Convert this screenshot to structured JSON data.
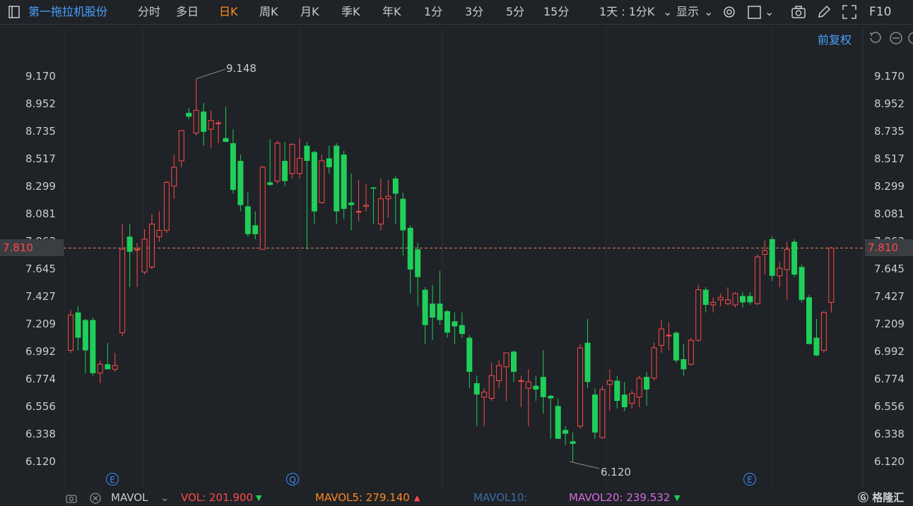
{
  "toolbar": {
    "stock_name": "第一拖拉机股份",
    "periods": [
      "分时",
      "多日",
      "日K",
      "周K",
      "月K",
      "季K",
      "年K",
      "1分",
      "3分",
      "5分",
      "15分"
    ],
    "active_period": "日K",
    "range_select": "1天 : 1分K",
    "display_label": "显示",
    "f10_label": "F10"
  },
  "chart": {
    "adjust_label": "前复权",
    "y_ticks": [
      "9.170",
      "8.952",
      "8.735",
      "8.517",
      "8.299",
      "8.081",
      "7.863",
      "7.645",
      "7.427",
      "7.209",
      "6.992",
      "6.774",
      "6.556",
      "6.338",
      "6.120"
    ],
    "current_price": "7.810",
    "high_label": "9.148",
    "low_label": "6.120",
    "event_markers": [
      "E",
      "Q",
      "E"
    ]
  },
  "bottom": {
    "indicator": "MAVOL",
    "vol": "VOL: 201.900",
    "mavol5": "MAVOL5: 279.140",
    "mavol10": "MAVOL10:",
    "mavol20": "MAVOL20: 239.532",
    "watermark": "格隆汇"
  },
  "colors": {
    "up": "#ff4a4a",
    "down": "#1fcf5a",
    "accent_blue": "#4aa0ff",
    "active_orange": "#ff8a1f",
    "mavol5": "#ff8a1f",
    "mavol10": "#3a6fa8",
    "mavol20": "#d86be0"
  },
  "chart_data": {
    "type": "candlestick",
    "ylim": [
      6.12,
      9.17
    ],
    "candles": [
      {
        "o": 7.0,
        "h": 7.32,
        "l": 6.98,
        "c": 7.28
      },
      {
        "o": 7.3,
        "h": 7.35,
        "l": 7.0,
        "c": 7.1
      },
      {
        "o": 7.24,
        "h": 7.25,
        "l": 6.82,
        "c": 7.0
      },
      {
        "o": 7.24,
        "h": 7.26,
        "l": 6.8,
        "c": 6.82
      },
      {
        "o": 6.82,
        "h": 6.92,
        "l": 6.74,
        "c": 6.89
      },
      {
        "o": 6.89,
        "h": 7.06,
        "l": 6.85,
        "c": 6.85
      },
      {
        "o": 6.85,
        "h": 6.98,
        "l": 6.83,
        "c": 6.88
      },
      {
        "o": 7.14,
        "h": 8.0,
        "l": 7.11,
        "c": 7.8
      },
      {
        "o": 7.9,
        "h": 8.0,
        "l": 7.5,
        "c": 7.78
      },
      {
        "o": 7.8,
        "h": 7.85,
        "l": 7.5,
        "c": 7.8
      },
      {
        "o": 7.62,
        "h": 7.96,
        "l": 7.6,
        "c": 7.88
      },
      {
        "o": 7.66,
        "h": 8.08,
        "l": 7.64,
        "c": 8.0
      },
      {
        "o": 7.9,
        "h": 8.1,
        "l": 7.86,
        "c": 7.95
      },
      {
        "o": 7.95,
        "h": 8.34,
        "l": 7.93,
        "c": 8.33
      },
      {
        "o": 8.3,
        "h": 8.55,
        "l": 8.2,
        "c": 8.45
      },
      {
        "o": 8.5,
        "h": 8.7,
        "l": 8.45,
        "c": 8.74
      },
      {
        "o": 8.88,
        "h": 8.92,
        "l": 8.83,
        "c": 8.85
      },
      {
        "o": 8.72,
        "h": 9.15,
        "l": 8.7,
        "c": 8.9
      },
      {
        "o": 8.89,
        "h": 8.96,
        "l": 8.62,
        "c": 8.73
      },
      {
        "o": 8.75,
        "h": 8.9,
        "l": 8.6,
        "c": 8.82
      },
      {
        "o": 8.8,
        "h": 8.82,
        "l": 8.64,
        "c": 8.8
      },
      {
        "o": 8.68,
        "h": 8.93,
        "l": 8.66,
        "c": 8.65
      },
      {
        "o": 8.64,
        "h": 8.75,
        "l": 8.24,
        "c": 8.27
      },
      {
        "o": 8.5,
        "h": 8.55,
        "l": 8.1,
        "c": 8.15
      },
      {
        "o": 8.14,
        "h": 8.25,
        "l": 7.9,
        "c": 7.92
      },
      {
        "o": 7.99,
        "h": 8.1,
        "l": 7.88,
        "c": 7.92
      },
      {
        "o": 7.8,
        "h": 8.46,
        "l": 7.8,
        "c": 8.45
      },
      {
        "o": 8.33,
        "h": 8.67,
        "l": 8.3,
        "c": 8.31
      },
      {
        "o": 8.34,
        "h": 8.66,
        "l": 8.32,
        "c": 8.64
      },
      {
        "o": 8.5,
        "h": 8.65,
        "l": 8.3,
        "c": 8.34
      },
      {
        "o": 8.4,
        "h": 8.64,
        "l": 8.36,
        "c": 8.63
      },
      {
        "o": 8.4,
        "h": 8.68,
        "l": 8.36,
        "c": 8.52
      },
      {
        "o": 8.62,
        "h": 8.65,
        "l": 7.8,
        "c": 8.5
      },
      {
        "o": 8.57,
        "h": 8.58,
        "l": 8.0,
        "c": 8.1
      },
      {
        "o": 8.17,
        "h": 8.55,
        "l": 8.16,
        "c": 8.5
      },
      {
        "o": 8.52,
        "h": 8.62,
        "l": 8.4,
        "c": 8.45
      },
      {
        "o": 8.62,
        "h": 8.64,
        "l": 8.0,
        "c": 8.1
      },
      {
        "o": 8.55,
        "h": 8.58,
        "l": 8.04,
        "c": 8.12
      },
      {
        "o": 8.17,
        "h": 8.4,
        "l": 7.95,
        "c": 8.15
      },
      {
        "o": 8.1,
        "h": 8.35,
        "l": 8.02,
        "c": 8.1
      },
      {
        "o": 8.14,
        "h": 8.32,
        "l": 8.1,
        "c": 8.15
      },
      {
        "o": 8.29,
        "h": 8.28,
        "l": 8.0,
        "c": 8.28
      },
      {
        "o": 8.0,
        "h": 8.36,
        "l": 7.95,
        "c": 8.2
      },
      {
        "o": 8.2,
        "h": 8.35,
        "l": 8.05,
        "c": 8.22
      },
      {
        "o": 8.36,
        "h": 8.38,
        "l": 8.0,
        "c": 8.24
      },
      {
        "o": 8.2,
        "h": 8.25,
        "l": 7.75,
        "c": 7.95
      },
      {
        "o": 7.97,
        "h": 7.99,
        "l": 7.45,
        "c": 7.64
      },
      {
        "o": 7.8,
        "h": 7.85,
        "l": 7.35,
        "c": 7.58
      },
      {
        "o": 7.48,
        "h": 7.5,
        "l": 7.05,
        "c": 7.2
      },
      {
        "o": 7.37,
        "h": 7.52,
        "l": 7.08,
        "c": 7.26
      },
      {
        "o": 7.37,
        "h": 7.63,
        "l": 7.2,
        "c": 7.24
      },
      {
        "o": 7.31,
        "h": 7.32,
        "l": 7.1,
        "c": 7.14
      },
      {
        "o": 7.23,
        "h": 7.3,
        "l": 7.05,
        "c": 7.19
      },
      {
        "o": 7.2,
        "h": 7.3,
        "l": 7.1,
        "c": 7.13
      },
      {
        "o": 7.1,
        "h": 7.12,
        "l": 6.7,
        "c": 6.83
      },
      {
        "o": 6.74,
        "h": 6.8,
        "l": 6.4,
        "c": 6.65
      },
      {
        "o": 6.63,
        "h": 6.7,
        "l": 6.4,
        "c": 6.67
      },
      {
        "o": 6.62,
        "h": 6.9,
        "l": 6.6,
        "c": 6.8
      },
      {
        "o": 6.76,
        "h": 6.92,
        "l": 6.7,
        "c": 6.88
      },
      {
        "o": 6.87,
        "h": 6.98,
        "l": 6.6,
        "c": 6.98
      },
      {
        "o": 6.99,
        "h": 7.0,
        "l": 6.75,
        "c": 6.83
      },
      {
        "o": 6.76,
        "h": 6.8,
        "l": 6.55,
        "c": 6.76
      },
      {
        "o": 6.7,
        "h": 6.85,
        "l": 6.4,
        "c": 6.75
      },
      {
        "o": 6.72,
        "h": 6.8,
        "l": 6.6,
        "c": 6.69
      },
      {
        "o": 6.79,
        "h": 7.0,
        "l": 6.5,
        "c": 6.63
      },
      {
        "o": 6.64,
        "h": 6.65,
        "l": 6.3,
        "c": 6.62
      },
      {
        "o": 6.56,
        "h": 6.62,
        "l": 6.36,
        "c": 6.3
      },
      {
        "o": 6.37,
        "h": 6.4,
        "l": 6.25,
        "c": 6.34
      },
      {
        "o": 6.28,
        "h": 6.35,
        "l": 6.12,
        "c": 6.26
      },
      {
        "o": 6.4,
        "h": 7.05,
        "l": 6.38,
        "c": 7.02
      },
      {
        "o": 7.06,
        "h": 7.25,
        "l": 6.7,
        "c": 6.75
      },
      {
        "o": 6.65,
        "h": 6.7,
        "l": 6.3,
        "c": 6.35
      },
      {
        "o": 6.31,
        "h": 6.72,
        "l": 6.3,
        "c": 6.69
      },
      {
        "o": 6.73,
        "h": 6.85,
        "l": 6.52,
        "c": 6.76
      },
      {
        "o": 6.76,
        "h": 6.8,
        "l": 6.54,
        "c": 6.6
      },
      {
        "o": 6.65,
        "h": 6.75,
        "l": 6.52,
        "c": 6.55
      },
      {
        "o": 6.58,
        "h": 6.68,
        "l": 6.54,
        "c": 6.66
      },
      {
        "o": 6.63,
        "h": 6.8,
        "l": 6.55,
        "c": 6.78
      },
      {
        "o": 6.79,
        "h": 6.83,
        "l": 6.56,
        "c": 6.69
      },
      {
        "o": 6.78,
        "h": 7.06,
        "l": 6.76,
        "c": 7.02
      },
      {
        "o": 7.04,
        "h": 7.24,
        "l": 6.98,
        "c": 7.17
      },
      {
        "o": 7.12,
        "h": 7.22,
        "l": 7.0,
        "c": 7.12
      },
      {
        "o": 7.14,
        "h": 7.15,
        "l": 6.9,
        "c": 6.92
      },
      {
        "o": 6.93,
        "h": 7.05,
        "l": 6.8,
        "c": 6.85
      },
      {
        "o": 6.89,
        "h": 7.1,
        "l": 6.88,
        "c": 7.08
      },
      {
        "o": 7.08,
        "h": 7.52,
        "l": 7.07,
        "c": 7.48
      },
      {
        "o": 7.48,
        "h": 7.5,
        "l": 7.3,
        "c": 7.36
      },
      {
        "o": 7.36,
        "h": 7.42,
        "l": 7.3,
        "c": 7.38
      },
      {
        "o": 7.4,
        "h": 7.45,
        "l": 7.35,
        "c": 7.42
      },
      {
        "o": 7.37,
        "h": 7.5,
        "l": 7.36,
        "c": 7.4
      },
      {
        "o": 7.36,
        "h": 7.46,
        "l": 7.34,
        "c": 7.45
      },
      {
        "o": 7.43,
        "h": 7.46,
        "l": 7.34,
        "c": 7.38
      },
      {
        "o": 7.43,
        "h": 7.46,
        "l": 7.36,
        "c": 7.38
      },
      {
        "o": 7.37,
        "h": 7.76,
        "l": 7.36,
        "c": 7.74
      },
      {
        "o": 7.76,
        "h": 7.87,
        "l": 7.6,
        "c": 7.79
      },
      {
        "o": 7.88,
        "h": 7.9,
        "l": 7.55,
        "c": 7.59
      },
      {
        "o": 7.59,
        "h": 7.7,
        "l": 7.5,
        "c": 7.65
      },
      {
        "o": 7.64,
        "h": 7.86,
        "l": 7.4,
        "c": 7.8
      },
      {
        "o": 7.86,
        "h": 7.88,
        "l": 7.58,
        "c": 7.6
      },
      {
        "o": 7.66,
        "h": 7.68,
        "l": 7.38,
        "c": 7.4
      },
      {
        "o": 7.42,
        "h": 7.44,
        "l": 7.06,
        "c": 7.05
      },
      {
        "o": 7.1,
        "h": 7.25,
        "l": 6.95,
        "c": 6.96
      },
      {
        "o": 7.0,
        "h": 7.31,
        "l": 6.98,
        "c": 7.3
      },
      {
        "o": 7.38,
        "h": 7.82,
        "l": 7.3,
        "c": 7.81
      }
    ]
  }
}
